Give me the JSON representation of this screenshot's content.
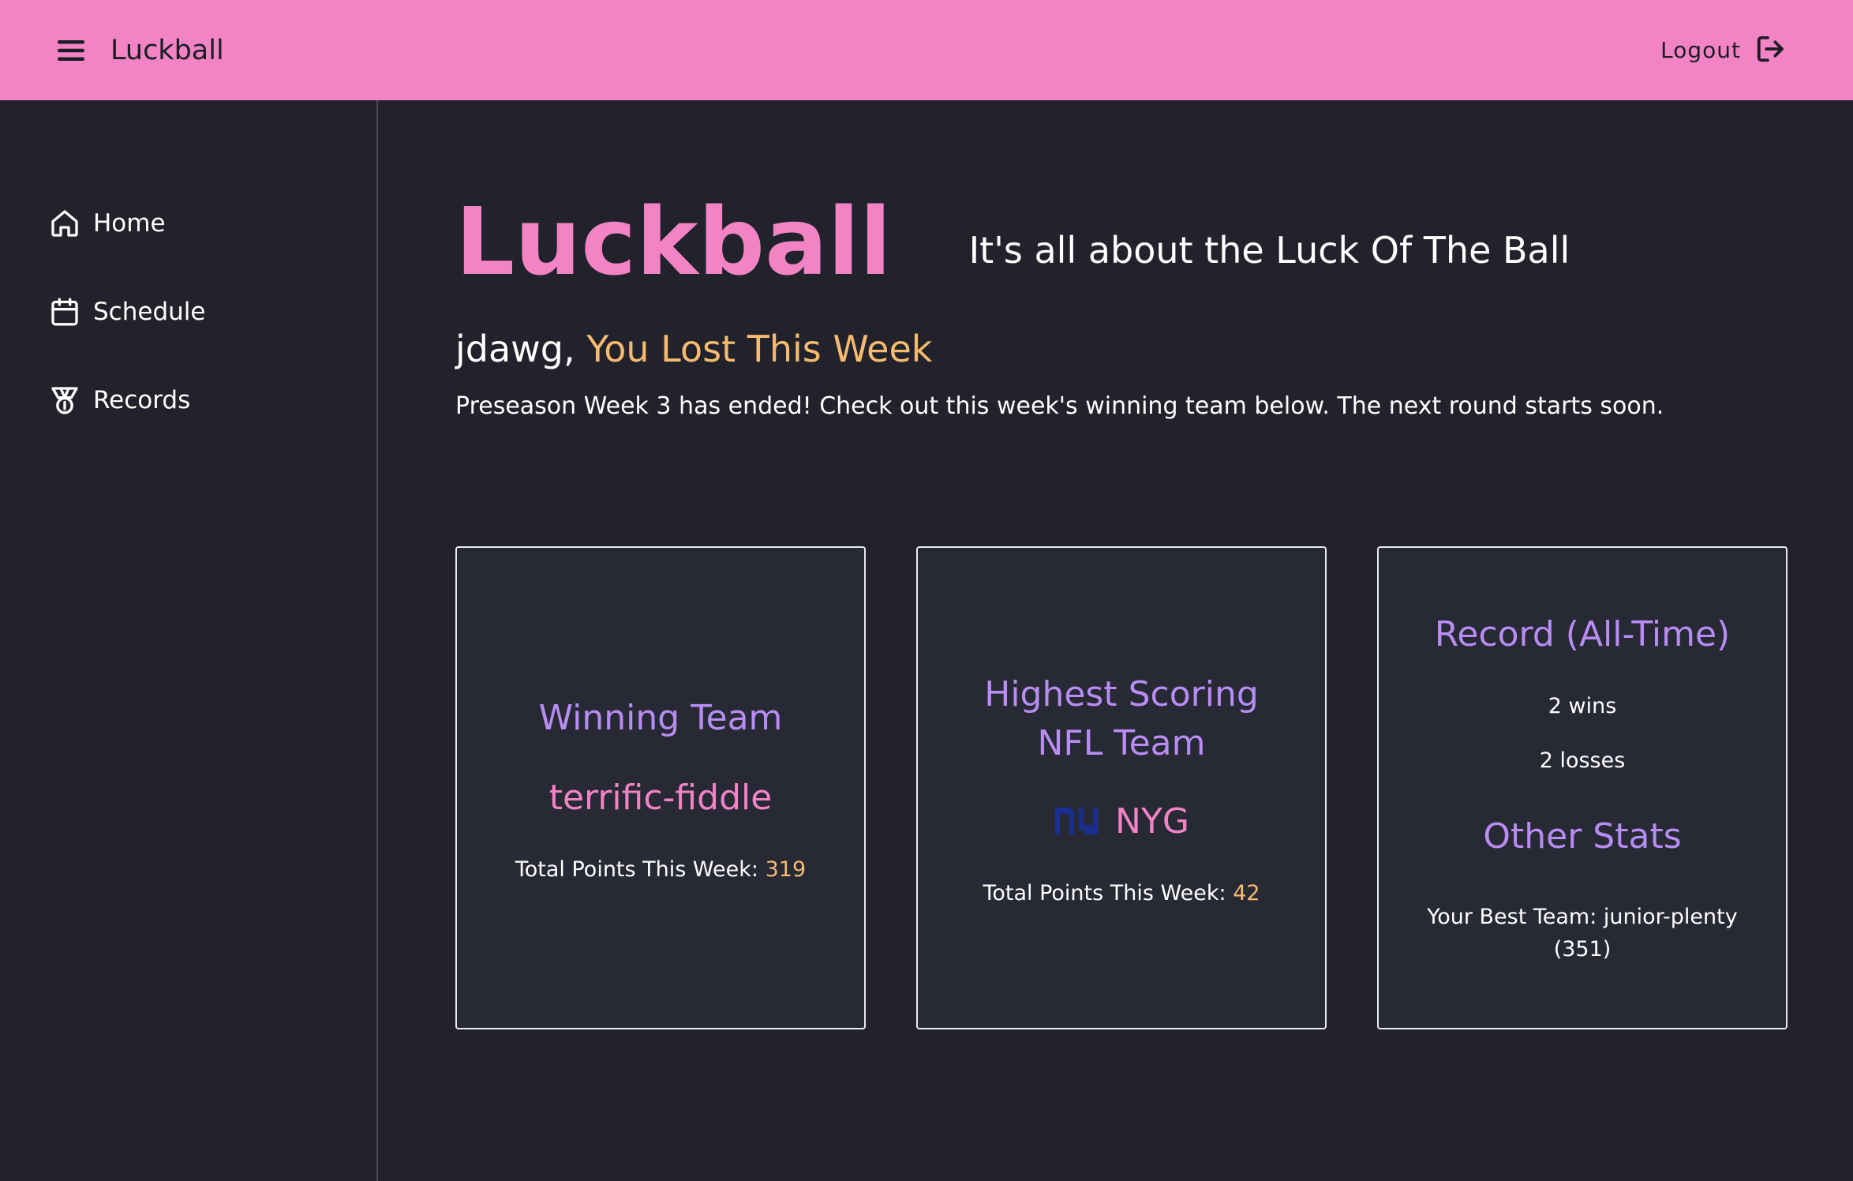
{
  "header": {
    "app_title": "Luckball",
    "logout_label": "Logout",
    "background_color": "#f283c5",
    "icons": {
      "menu": "hamburger-menu-icon",
      "logout": "logout-icon"
    }
  },
  "sidebar": {
    "items": [
      {
        "label": "Home",
        "icon": "home-icon"
      },
      {
        "label": "Schedule",
        "icon": "calendar-icon"
      },
      {
        "label": "Records",
        "icon": "medal-icon"
      }
    ]
  },
  "main": {
    "title": "Luckball",
    "tagline": "It's all about the Luck Of The Ball",
    "greeting_user": "jdawg,",
    "greeting_status": "You Lost This Week",
    "description": "Preseason Week 3 has ended! Check out this week's winning team below. The next round starts soon."
  },
  "cards": {
    "winning": {
      "heading": "Winning Team",
      "team_name": "terrific-fiddle",
      "points_label": "Total Points This Week:",
      "points_value": "319"
    },
    "nfl": {
      "heading_line1": "Highest Scoring",
      "heading_line2": "NFL Team",
      "team_abbr": "NYG",
      "logo_icon": "ny-giants-logo-icon",
      "points_label": "Total Points This Week:",
      "points_value": "42"
    },
    "record": {
      "heading": "Record (All-Time)",
      "wins": "2 wins",
      "losses": "2 losses",
      "other_heading": "Other Stats",
      "best_team": "Your Best Team: junior-plenty (351)"
    }
  },
  "colors": {
    "accent_pink": "#f283c5",
    "accent_purple": "#b88df3",
    "accent_orange": "#f6bb6f",
    "background": "#21222c",
    "card_background": "#272935"
  }
}
